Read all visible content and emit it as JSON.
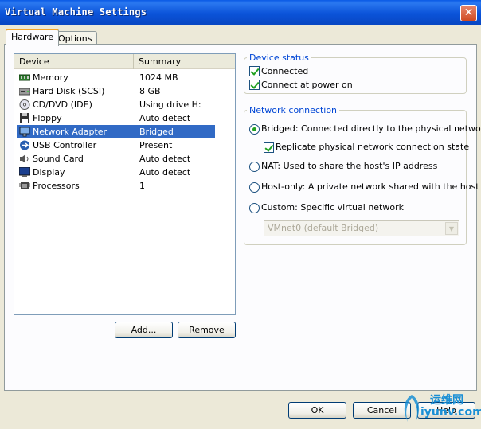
{
  "window": {
    "title": "Virtual Machine Settings",
    "close_glyph": "✕"
  },
  "tabs": [
    {
      "label": "Hardware",
      "active": true
    },
    {
      "label": "Options",
      "active": false
    }
  ],
  "devices": {
    "columns": [
      "Device",
      "Summary"
    ],
    "rows": [
      {
        "name": "Memory",
        "summary": "1024 MB",
        "icon": "memory-icon"
      },
      {
        "name": "Hard Disk (SCSI)",
        "summary": "8 GB",
        "icon": "hard-disk-icon"
      },
      {
        "name": "CD/DVD (IDE)",
        "summary": "Using drive H:",
        "icon": "cd-dvd-icon"
      },
      {
        "name": "Floppy",
        "summary": "Auto detect",
        "icon": "floppy-icon"
      },
      {
        "name": "Network Adapter",
        "summary": "Bridged",
        "icon": "network-adapter-icon",
        "selected": true
      },
      {
        "name": "USB Controller",
        "summary": "Present",
        "icon": "usb-icon"
      },
      {
        "name": "Sound Card",
        "summary": "Auto detect",
        "icon": "sound-card-icon"
      },
      {
        "name": "Display",
        "summary": "Auto detect",
        "icon": "display-icon"
      },
      {
        "name": "Processors",
        "summary": "1",
        "icon": "processor-icon"
      }
    ]
  },
  "buttons": {
    "add": "Add...",
    "remove": "Remove",
    "ok": "OK",
    "cancel": "Cancel",
    "help": "Help"
  },
  "device_status": {
    "legend": "Device status",
    "connected": {
      "label": "Connected",
      "checked": true
    },
    "connect_at_power_on": {
      "label": "Connect at power on",
      "checked": true
    }
  },
  "network_connection": {
    "legend": "Network connection",
    "bridged": {
      "label": "Bridged: Connected directly to the physical network",
      "selected": true
    },
    "replicate": {
      "label": "Replicate physical network connection state",
      "checked": true
    },
    "nat": {
      "label": "NAT: Used to share the host's IP address",
      "selected": false
    },
    "host_only": {
      "label": "Host-only: A private network shared with the host",
      "selected": false
    },
    "custom": {
      "label": "Custom: Specific virtual network",
      "selected": false
    },
    "vmnet_select": {
      "value": "VMnet0 (default Bridged)",
      "disabled": true
    }
  },
  "watermark": {
    "line1": "运维网",
    "line2": "iyunv.com"
  },
  "colors": {
    "title_bar": "#0b53d9",
    "selection": "#316ac5",
    "legend_text": "#0046d5",
    "check_mark": "#21a121"
  }
}
